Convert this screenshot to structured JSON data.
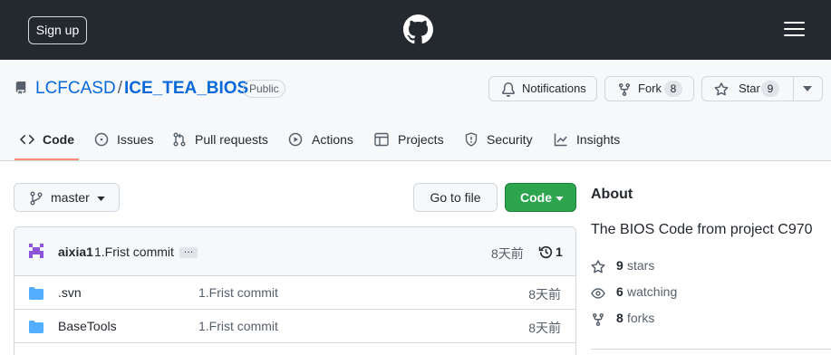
{
  "header": {
    "signup_label": "Sign up",
    "logo_icon": "github-mark-icon",
    "menu_icon": "hamburger-menu-icon"
  },
  "repo": {
    "owner": "LCFCASD",
    "separator": "/",
    "name": "ICE_TEA_BIOS",
    "visibility": "Public",
    "notifications_label": "Notifications",
    "fork_label": "Fork",
    "fork_count": "8",
    "star_label": "Star",
    "star_count": "9"
  },
  "tabs": [
    {
      "label": "Code",
      "icon": "code-icon",
      "active": true
    },
    {
      "label": "Issues",
      "icon": "issue-opened-icon"
    },
    {
      "label": "Pull requests",
      "icon": "git-pull-request-icon"
    },
    {
      "label": "Actions",
      "icon": "play-icon"
    },
    {
      "label": "Projects",
      "icon": "table-icon"
    },
    {
      "label": "Security",
      "icon": "shield-icon"
    },
    {
      "label": "Insights",
      "icon": "graph-icon"
    }
  ],
  "toolbar": {
    "branch": "master",
    "goto_file_label": "Go to file",
    "code_label": "Code"
  },
  "commit": {
    "author": "aixia1",
    "message": "1.Frist commit",
    "ellipsis": "…",
    "age": "8天前",
    "commits_count": "1"
  },
  "files": [
    {
      "name": ".svn",
      "message": "1.Frist commit",
      "age": "8天前",
      "type": "directory"
    },
    {
      "name": "BaseTools",
      "message": "1.Frist commit",
      "age": "8天前",
      "type": "directory"
    }
  ],
  "about": {
    "title": "About",
    "description": "The BIOS Code from project C970",
    "stars_count": "9",
    "stars_label": "stars",
    "watching_count": "6",
    "watching_label": "watching",
    "forks_count": "8",
    "forks_label": "forks"
  },
  "colors": {
    "header_bg": "#24292f",
    "link": "#0969da",
    "code_button": "#2da44e",
    "active_tab_underline": "#fd8c73"
  }
}
